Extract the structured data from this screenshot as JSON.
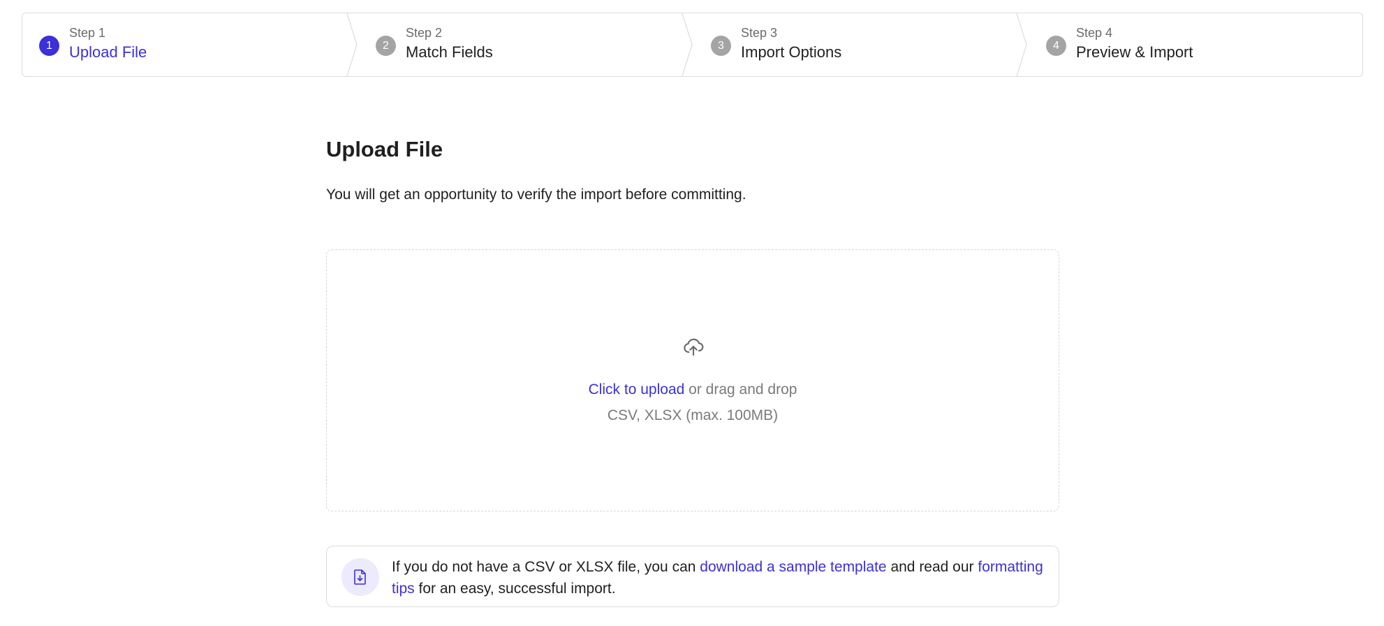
{
  "stepper": {
    "steps": [
      {
        "number": "1",
        "label": "Step 1",
        "title": "Upload File",
        "state": "active"
      },
      {
        "number": "2",
        "label": "Step 2",
        "title": "Match Fields",
        "state": "upcoming"
      },
      {
        "number": "3",
        "label": "Step 3",
        "title": "Import Options",
        "state": "upcoming"
      },
      {
        "number": "4",
        "label": "Step 4",
        "title": "Preview & Import",
        "state": "upcoming"
      }
    ]
  },
  "main": {
    "title": "Upload File",
    "subtitle": "You will get an opportunity to verify the import before committing."
  },
  "dropzone": {
    "icon": "cloud-upload-icon",
    "click_label": "Click to upload",
    "drag_label": " or drag and drop",
    "formats": "CSV, XLSX (max. 100MB)"
  },
  "info": {
    "icon": "file-download-icon",
    "text_before": "If you do not have a CSV or XLSX file, you can ",
    "template_link": "download a sample template",
    "text_middle": " and read our ",
    "tips_link": "formatting tips",
    "text_after": " for an easy, successful import."
  },
  "colors": {
    "accent": "#3b30d9",
    "inactive_step": "#a4a4a4",
    "muted_text": "#7a7a7a",
    "border": "#dcdcdc",
    "icon_bg": "#eceafb"
  }
}
